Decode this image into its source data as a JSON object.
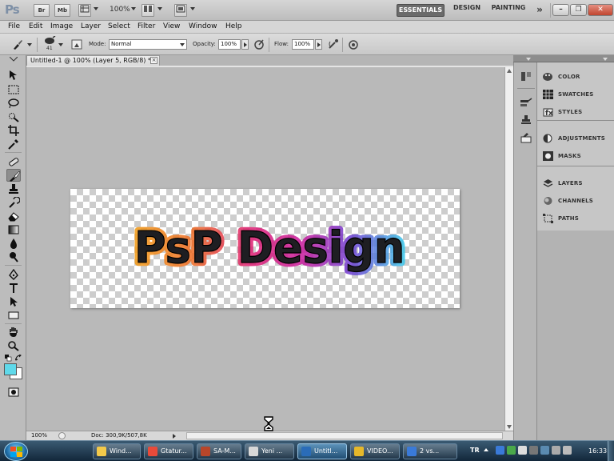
{
  "app": {
    "logo": "Ps",
    "zoom_display": "100%",
    "bridge_label": "Br",
    "minibridge_label": "Mb"
  },
  "workspaces": {
    "essentials": "ESSENTIALS",
    "design": "DESIGN",
    "painting": "PAINTING",
    "more": "»"
  },
  "menu": [
    "File",
    "Edit",
    "Image",
    "Layer",
    "Select",
    "Filter",
    "View",
    "Window",
    "Help"
  ],
  "options": {
    "brush_size": "41",
    "mode_label": "Mode:",
    "mode_value": "Normal",
    "opacity_label": "Opacity:",
    "opacity_value": "100%",
    "flow_label": "Flow:",
    "flow_value": "100%"
  },
  "document": {
    "tab_title": "Untitled-1 @ 100% (Layer 5, RGB/8) *",
    "tab_close": "×",
    "artwork_text": "PsP Design"
  },
  "status": {
    "zoom": "100%",
    "doc_info": "Doc: 300,9K/507,8K"
  },
  "panels": {
    "group1": [
      "COLOR",
      "SWATCHES",
      "STYLES"
    ],
    "group2": [
      "ADJUSTMENTS",
      "MASKS"
    ],
    "group3": [
      "LAYERS",
      "CHANNELS",
      "PATHS"
    ]
  },
  "colors": {
    "foreground": "#000000",
    "background_swatch": "#5fd9ea",
    "accent_orange": "#f08a1a",
    "accent_magenta": "#d81a86",
    "accent_cyan": "#38c8e8"
  },
  "taskbar": {
    "tasks": [
      {
        "label": "Wind...",
        "icon_color": "#f2c94a"
      },
      {
        "label": "Gtatur...",
        "icon_color": "#e84a3a"
      },
      {
        "label": "SA-M...",
        "icon_color": "#b8462a"
      },
      {
        "label": "Yeni ...",
        "icon_color": "#d8d8d8"
      },
      {
        "label": "Untitl...",
        "icon_color": "#2a6cb8"
      },
      {
        "label": "VIDEO...",
        "icon_color": "#e6b82a"
      },
      {
        "label": "2 vs...",
        "icon_color": "#3a7ad8"
      }
    ],
    "language": "TR",
    "clock": "16:33"
  }
}
